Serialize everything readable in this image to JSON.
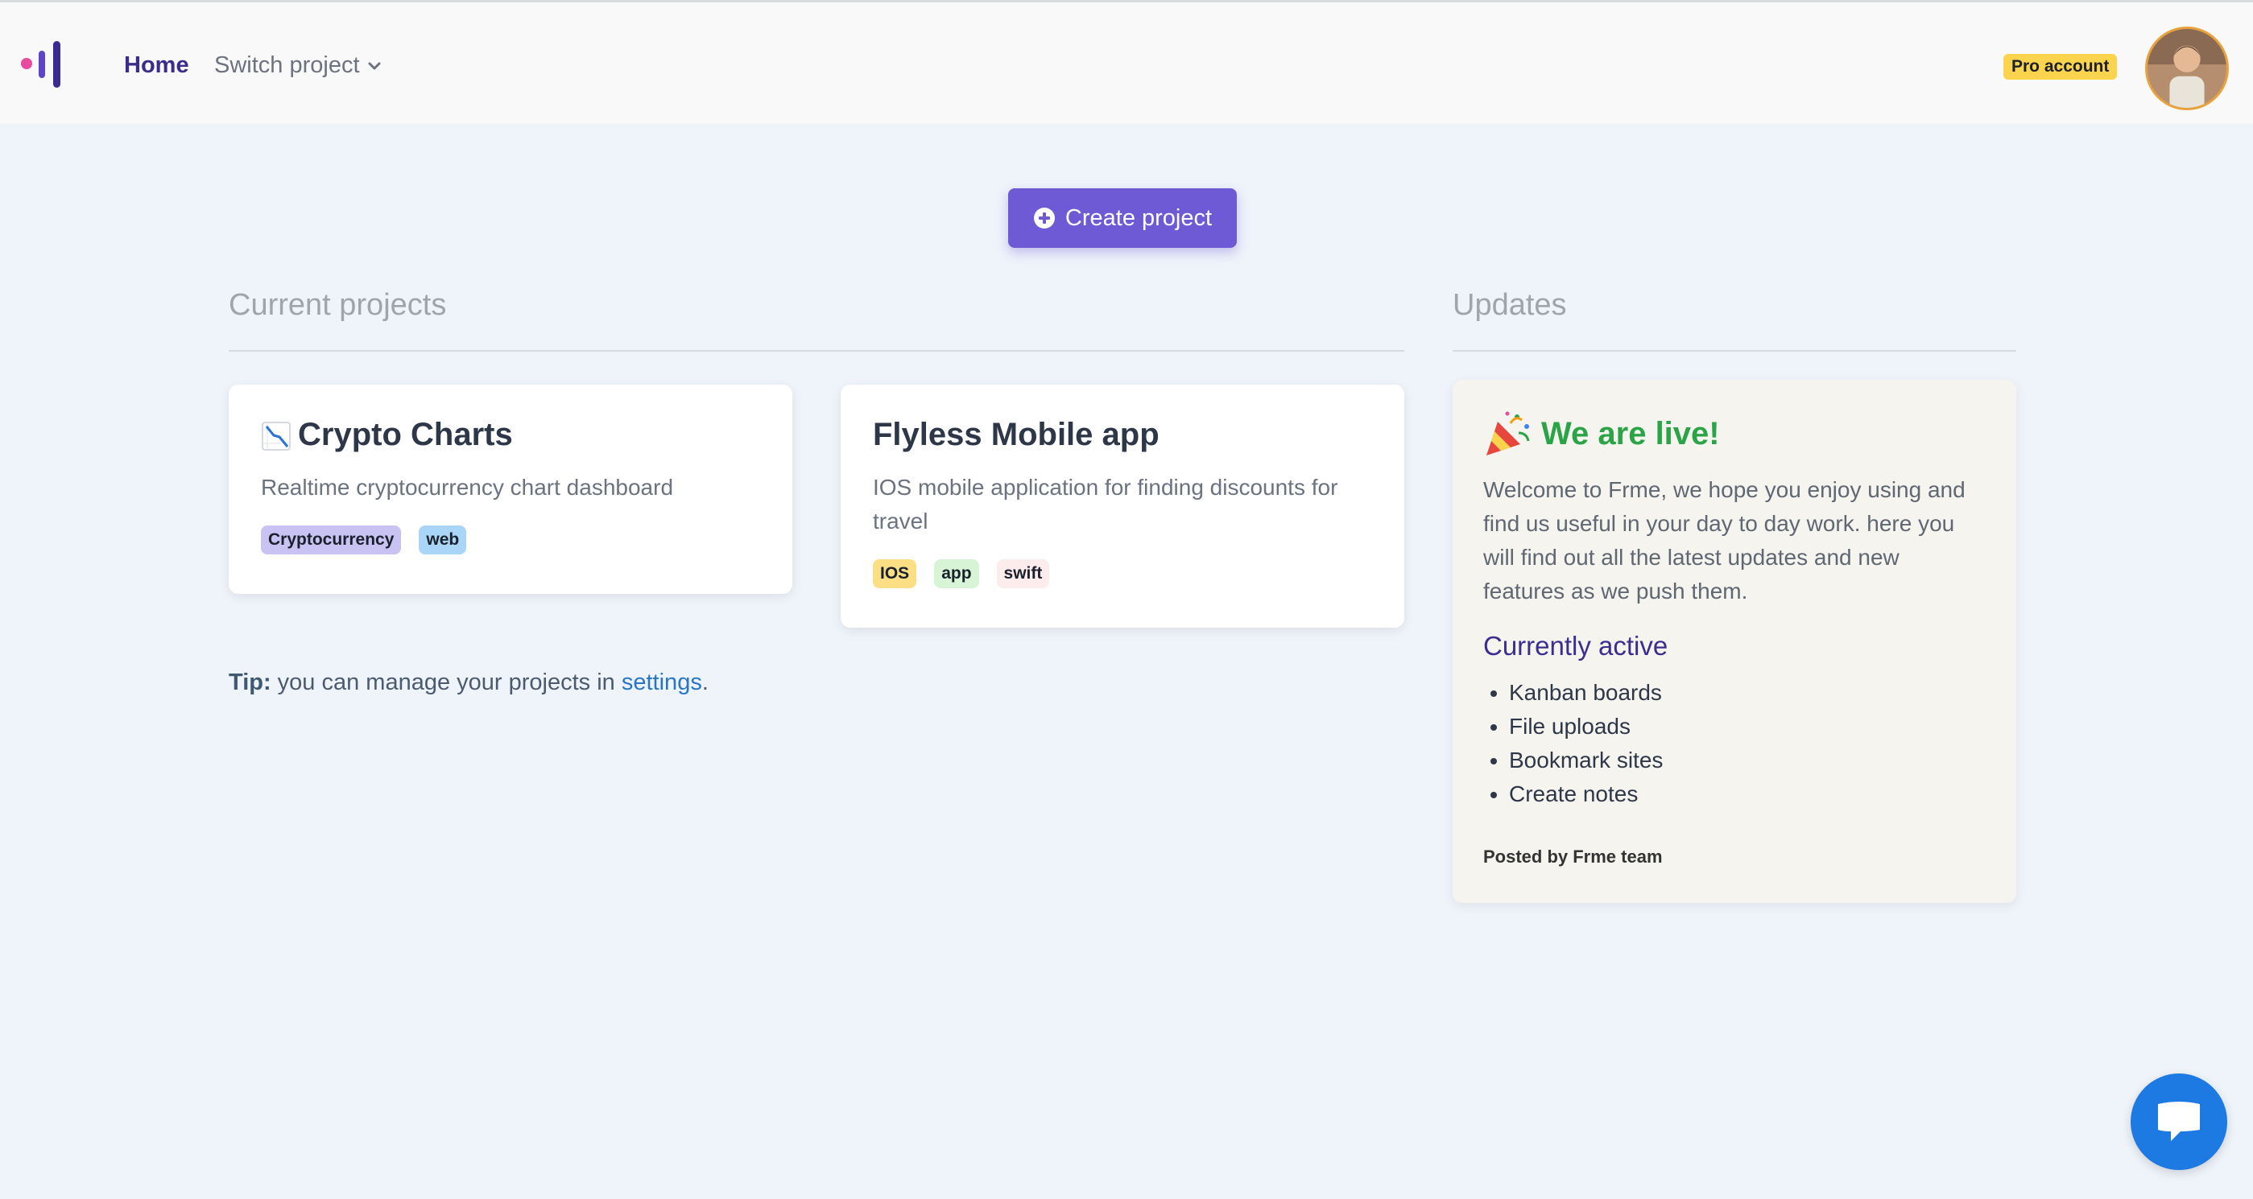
{
  "nav": {
    "home": "Home",
    "switch_project": "Switch project",
    "pro_badge": "Pro account"
  },
  "actions": {
    "create_project": "Create project"
  },
  "sections": {
    "current_projects": "Current projects",
    "updates": "Updates"
  },
  "projects": [
    {
      "title": "Crypto Charts",
      "icon": "chart-decreasing-icon",
      "description": "Realtime cryptocurrency chart dashboard",
      "tags": [
        {
          "label": "Cryptocurrency",
          "color": "#c9c3f4"
        },
        {
          "label": "web",
          "color": "#a9d6f7"
        }
      ]
    },
    {
      "title": "Flyless Mobile app",
      "description": "IOS mobile application for finding discounts for travel",
      "tags": [
        {
          "label": "IOS",
          "color": "#fcdf84"
        },
        {
          "label": "app",
          "color": "#d7f5d6"
        },
        {
          "label": "swift",
          "color": "#fdecec"
        }
      ]
    }
  ],
  "tip": {
    "prefix": "Tip:",
    "text": " you can manage your projects in ",
    "link": "settings",
    "suffix": "."
  },
  "update": {
    "icon": "party-popper-icon",
    "title": "We are live!",
    "body": "Welcome to Frme, we hope you enjoy using and find us useful in your day to day work. here you will find out all the latest updates and new features as we push them.",
    "active_title": "Currently active",
    "features": [
      "Kanban boards",
      "File uploads",
      "Bookmark sites",
      "Create notes"
    ],
    "posted_by": "Posted by Frme team"
  },
  "colors": {
    "accent": "#6f5ad5",
    "nav_active": "#3c2c8c",
    "live_green": "#2aa446",
    "chat_blue": "#1c7ae2",
    "pro_yellow": "#fbd34d"
  }
}
